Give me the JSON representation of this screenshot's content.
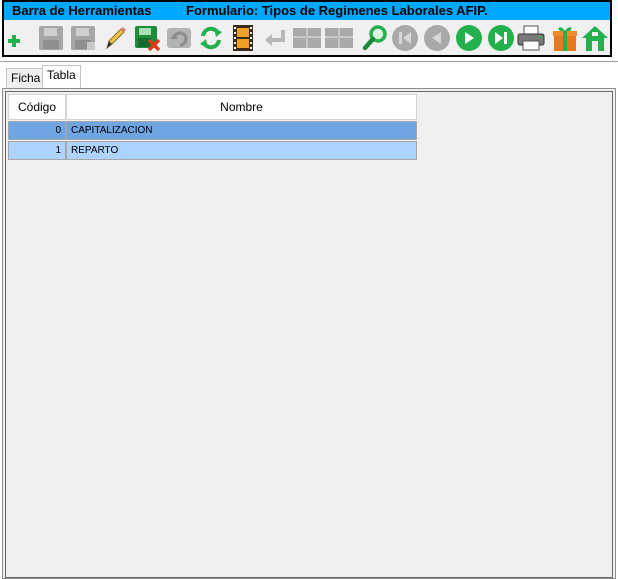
{
  "toolbar": {
    "app_label": "Barra de Herramientas",
    "form_title": "Formulario: Tipos de Regimenes Laborales AFIP.",
    "buttons": [
      {
        "icon": "add-icon",
        "enabled": true
      },
      {
        "icon": "save-icon",
        "enabled": false
      },
      {
        "icon": "save-as-icon",
        "enabled": false
      },
      {
        "icon": "edit-pencil-icon",
        "enabled": true
      },
      {
        "icon": "delete-save-icon",
        "enabled": true
      },
      {
        "icon": "undo-icon",
        "enabled": false
      },
      {
        "icon": "refresh-icon",
        "enabled": true
      },
      {
        "icon": "film-icon",
        "enabled": true
      },
      {
        "icon": "return-arrow-icon",
        "enabled": false
      },
      {
        "icon": "grid-icon",
        "enabled": false
      },
      {
        "icon": "grid-icon-2",
        "enabled": false
      },
      {
        "icon": "search-icon",
        "enabled": true
      },
      {
        "icon": "first-record-icon",
        "enabled": false
      },
      {
        "icon": "previous-record-icon",
        "enabled": false
      },
      {
        "icon": "next-record-icon",
        "enabled": true
      },
      {
        "icon": "last-record-icon",
        "enabled": true
      },
      {
        "icon": "printer-icon",
        "enabled": true
      },
      {
        "icon": "gift-icon",
        "enabled": true
      },
      {
        "icon": "home-icon",
        "enabled": true
      }
    ]
  },
  "tabs": [
    {
      "label": "Ficha",
      "active": false
    },
    {
      "label": "Tabla",
      "active": true
    }
  ],
  "table": {
    "columns": [
      "Código",
      "Nombre"
    ],
    "rows": [
      {
        "code": "0",
        "name": "CAPITALIZACION"
      },
      {
        "code": "1",
        "name": "REPARTO"
      }
    ]
  },
  "colors": {
    "title_bar": "#00a8ff",
    "selected_row": "#6fa5e0",
    "row_highlight": "#aed3ff",
    "enabled_green": "#22b14c",
    "disabled_gray": "#a9a9a9"
  }
}
